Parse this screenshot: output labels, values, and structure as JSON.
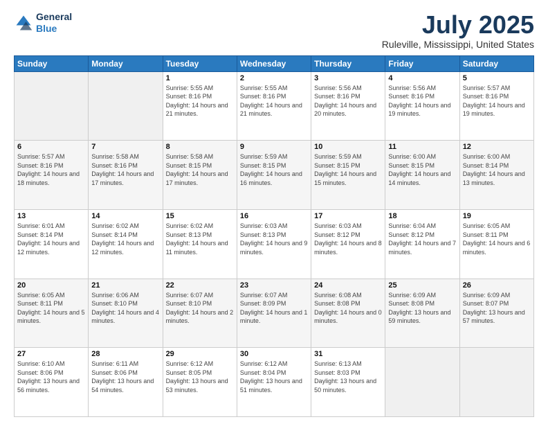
{
  "logo": {
    "line1": "General",
    "line2": "Blue"
  },
  "header": {
    "title": "July 2025",
    "subtitle": "Ruleville, Mississippi, United States"
  },
  "weekdays": [
    "Sunday",
    "Monday",
    "Tuesday",
    "Wednesday",
    "Thursday",
    "Friday",
    "Saturday"
  ],
  "weeks": [
    [
      {
        "day": "",
        "sunrise": "",
        "sunset": "",
        "daylight": ""
      },
      {
        "day": "",
        "sunrise": "",
        "sunset": "",
        "daylight": ""
      },
      {
        "day": "1",
        "sunrise": "Sunrise: 5:55 AM",
        "sunset": "Sunset: 8:16 PM",
        "daylight": "Daylight: 14 hours and 21 minutes."
      },
      {
        "day": "2",
        "sunrise": "Sunrise: 5:55 AM",
        "sunset": "Sunset: 8:16 PM",
        "daylight": "Daylight: 14 hours and 21 minutes."
      },
      {
        "day": "3",
        "sunrise": "Sunrise: 5:56 AM",
        "sunset": "Sunset: 8:16 PM",
        "daylight": "Daylight: 14 hours and 20 minutes."
      },
      {
        "day": "4",
        "sunrise": "Sunrise: 5:56 AM",
        "sunset": "Sunset: 8:16 PM",
        "daylight": "Daylight: 14 hours and 19 minutes."
      },
      {
        "day": "5",
        "sunrise": "Sunrise: 5:57 AM",
        "sunset": "Sunset: 8:16 PM",
        "daylight": "Daylight: 14 hours and 19 minutes."
      }
    ],
    [
      {
        "day": "6",
        "sunrise": "Sunrise: 5:57 AM",
        "sunset": "Sunset: 8:16 PM",
        "daylight": "Daylight: 14 hours and 18 minutes."
      },
      {
        "day": "7",
        "sunrise": "Sunrise: 5:58 AM",
        "sunset": "Sunset: 8:16 PM",
        "daylight": "Daylight: 14 hours and 17 minutes."
      },
      {
        "day": "8",
        "sunrise": "Sunrise: 5:58 AM",
        "sunset": "Sunset: 8:15 PM",
        "daylight": "Daylight: 14 hours and 17 minutes."
      },
      {
        "day": "9",
        "sunrise": "Sunrise: 5:59 AM",
        "sunset": "Sunset: 8:15 PM",
        "daylight": "Daylight: 14 hours and 16 minutes."
      },
      {
        "day": "10",
        "sunrise": "Sunrise: 5:59 AM",
        "sunset": "Sunset: 8:15 PM",
        "daylight": "Daylight: 14 hours and 15 minutes."
      },
      {
        "day": "11",
        "sunrise": "Sunrise: 6:00 AM",
        "sunset": "Sunset: 8:15 PM",
        "daylight": "Daylight: 14 hours and 14 minutes."
      },
      {
        "day": "12",
        "sunrise": "Sunrise: 6:00 AM",
        "sunset": "Sunset: 8:14 PM",
        "daylight": "Daylight: 14 hours and 13 minutes."
      }
    ],
    [
      {
        "day": "13",
        "sunrise": "Sunrise: 6:01 AM",
        "sunset": "Sunset: 8:14 PM",
        "daylight": "Daylight: 14 hours and 12 minutes."
      },
      {
        "day": "14",
        "sunrise": "Sunrise: 6:02 AM",
        "sunset": "Sunset: 8:14 PM",
        "daylight": "Daylight: 14 hours and 12 minutes."
      },
      {
        "day": "15",
        "sunrise": "Sunrise: 6:02 AM",
        "sunset": "Sunset: 8:13 PM",
        "daylight": "Daylight: 14 hours and 11 minutes."
      },
      {
        "day": "16",
        "sunrise": "Sunrise: 6:03 AM",
        "sunset": "Sunset: 8:13 PM",
        "daylight": "Daylight: 14 hours and 9 minutes."
      },
      {
        "day": "17",
        "sunrise": "Sunrise: 6:03 AM",
        "sunset": "Sunset: 8:12 PM",
        "daylight": "Daylight: 14 hours and 8 minutes."
      },
      {
        "day": "18",
        "sunrise": "Sunrise: 6:04 AM",
        "sunset": "Sunset: 8:12 PM",
        "daylight": "Daylight: 14 hours and 7 minutes."
      },
      {
        "day": "19",
        "sunrise": "Sunrise: 6:05 AM",
        "sunset": "Sunset: 8:11 PM",
        "daylight": "Daylight: 14 hours and 6 minutes."
      }
    ],
    [
      {
        "day": "20",
        "sunrise": "Sunrise: 6:05 AM",
        "sunset": "Sunset: 8:11 PM",
        "daylight": "Daylight: 14 hours and 5 minutes."
      },
      {
        "day": "21",
        "sunrise": "Sunrise: 6:06 AM",
        "sunset": "Sunset: 8:10 PM",
        "daylight": "Daylight: 14 hours and 4 minutes."
      },
      {
        "day": "22",
        "sunrise": "Sunrise: 6:07 AM",
        "sunset": "Sunset: 8:10 PM",
        "daylight": "Daylight: 14 hours and 2 minutes."
      },
      {
        "day": "23",
        "sunrise": "Sunrise: 6:07 AM",
        "sunset": "Sunset: 8:09 PM",
        "daylight": "Daylight: 14 hours and 1 minute."
      },
      {
        "day": "24",
        "sunrise": "Sunrise: 6:08 AM",
        "sunset": "Sunset: 8:08 PM",
        "daylight": "Daylight: 14 hours and 0 minutes."
      },
      {
        "day": "25",
        "sunrise": "Sunrise: 6:09 AM",
        "sunset": "Sunset: 8:08 PM",
        "daylight": "Daylight: 13 hours and 59 minutes."
      },
      {
        "day": "26",
        "sunrise": "Sunrise: 6:09 AM",
        "sunset": "Sunset: 8:07 PM",
        "daylight": "Daylight: 13 hours and 57 minutes."
      }
    ],
    [
      {
        "day": "27",
        "sunrise": "Sunrise: 6:10 AM",
        "sunset": "Sunset: 8:06 PM",
        "daylight": "Daylight: 13 hours and 56 minutes."
      },
      {
        "day": "28",
        "sunrise": "Sunrise: 6:11 AM",
        "sunset": "Sunset: 8:06 PM",
        "daylight": "Daylight: 13 hours and 54 minutes."
      },
      {
        "day": "29",
        "sunrise": "Sunrise: 6:12 AM",
        "sunset": "Sunset: 8:05 PM",
        "daylight": "Daylight: 13 hours and 53 minutes."
      },
      {
        "day": "30",
        "sunrise": "Sunrise: 6:12 AM",
        "sunset": "Sunset: 8:04 PM",
        "daylight": "Daylight: 13 hours and 51 minutes."
      },
      {
        "day": "31",
        "sunrise": "Sunrise: 6:13 AM",
        "sunset": "Sunset: 8:03 PM",
        "daylight": "Daylight: 13 hours and 50 minutes."
      },
      {
        "day": "",
        "sunrise": "",
        "sunset": "",
        "daylight": ""
      },
      {
        "day": "",
        "sunrise": "",
        "sunset": "",
        "daylight": ""
      }
    ]
  ]
}
